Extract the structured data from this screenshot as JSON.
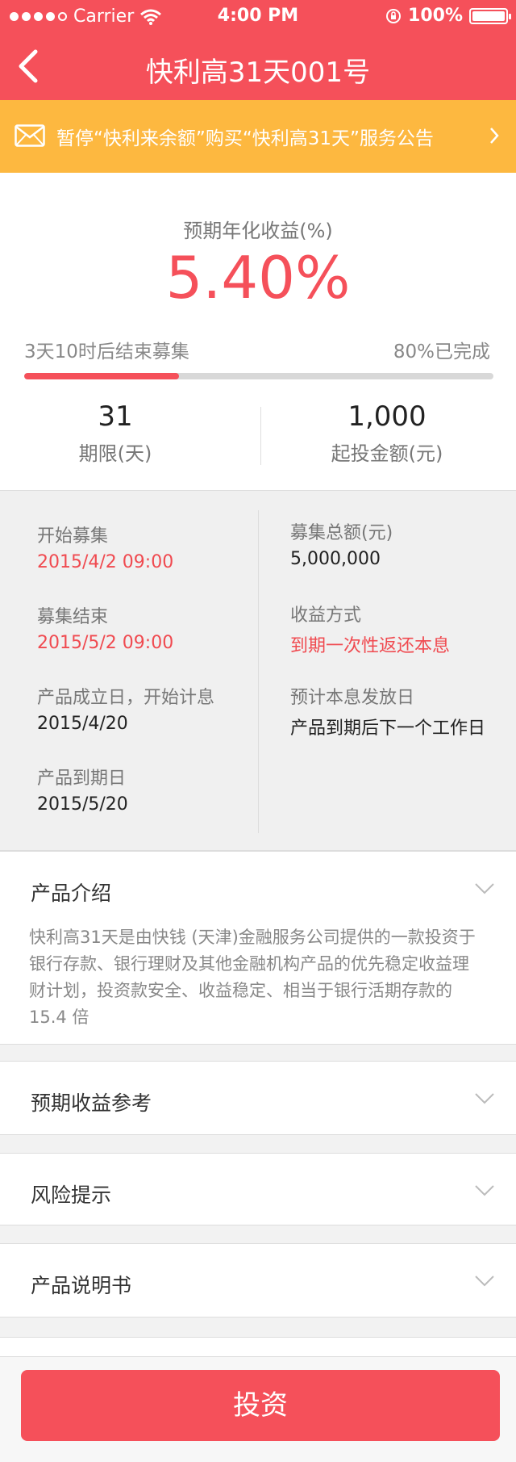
{
  "status_bar": {
    "carrier": "Carrier",
    "time": "4:00 PM",
    "battery": "100%"
  },
  "nav": {
    "title": "快利高31天001号"
  },
  "notice": {
    "text": "暂停“快利来余额”购买“快利高31天”服务公告"
  },
  "summary": {
    "yield_label": "预期年化收益(%)",
    "yield_value": "5.40%",
    "countdown": "3天10时后结束募集",
    "completion_text": "80%已完成",
    "progress_fraction": 0.33,
    "term_value": "31",
    "term_label": "期限(天)",
    "min_invest_value": "1,000",
    "min_invest_label": "起投金额(元)"
  },
  "details": {
    "start_label": "开始募集",
    "start_value": "2015/4/2 09:00",
    "end_label": "募集结束",
    "end_value": "2015/5/2 09:00",
    "established_label": "产品成立日，开始计息",
    "established_value": "2015/4/20",
    "maturity_label": "产品到期日",
    "maturity_value": "2015/5/20",
    "total_label": "募集总额(元)",
    "total_value": "5,000,000",
    "method_label": "收益方式",
    "method_value": "到期一次性返还本息",
    "payout_label": "预计本息发放日",
    "payout_value": "产品到期后下一个工作日"
  },
  "sections": {
    "intro_title": "产品介绍",
    "intro_body": "快利高31天是由快钱 (天津)金融服务公司提供的一款投资于银行存款、银行理财及其他金融机构产品的优先稳定收益理财计划，投资款安全、收益稳定、相当于银行活期存款的15.4 倍",
    "expected_title": "预期收益参考",
    "risk_title": "风险提示",
    "manual_title": "产品说明书"
  },
  "bottom": {
    "invest_label": "投资"
  },
  "colors": {
    "primary": "#f5505a",
    "notice": "#fdb840"
  }
}
